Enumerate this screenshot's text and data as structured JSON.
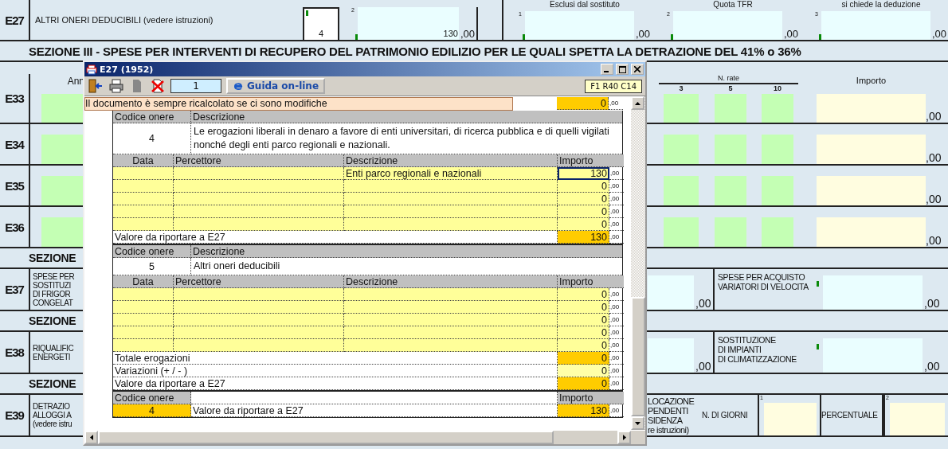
{
  "form": {
    "e27": {
      "code": "E27",
      "label": "ALTRI ONERI DEDUCIBILI (vedere istruzioni)",
      "code_field": "4",
      "amount_index": "2",
      "amount": "130",
      "decimals": ",00"
    },
    "e32": [
      {
        "heading": "Esclusi dal sostituto",
        "index": "1",
        "decimals": ",00"
      },
      {
        "heading": "Quota TFR",
        "index": "2",
        "decimals": ",00"
      },
      {
        "heading": "si chiede la deduzione",
        "index": "3",
        "decimals": ",00"
      }
    ],
    "section_title": "SEZIONE III  -  SPESE PER INTERVENTI DI RECUPERO DEL PATRIMONIO EDILIZIO PER LE QUALI SPETTA LA DETRAZIONE DEL 41% o 36%",
    "rate_header": {
      "year_heading": "Ann",
      "rate_heading": "N. rate",
      "rates": [
        "3",
        "5",
        "10"
      ],
      "amount_heading": "Importo"
    },
    "rate_rows": [
      {
        "code": "E33",
        "decimals": ",00"
      },
      {
        "code": "E34",
        "decimals": ",00"
      },
      {
        "code": "E35",
        "decimals": ",00"
      },
      {
        "code": "E36",
        "decimals": ",00"
      }
    ],
    "lower_sections": [
      {
        "title": "SEZIONE",
        "row": {
          "kind": "split",
          "code": "E37",
          "label_lines": [
            "SPESE PER",
            "SOSTITUZI",
            "DI FRIGOR",
            "CONGELAT"
          ],
          "left_decimals": ",00",
          "right_label_lines": [
            "SPESE PER ACQUISTO",
            "VARIATORI DI VELOCITA"
          ],
          "right_decimals": ",00"
        }
      },
      {
        "title": "SEZIONE",
        "row": {
          "kind": "split",
          "code": "E38",
          "label_lines": [
            "RIQUALIFIC",
            "ENERGETI"
          ],
          "left_decimals": ",00",
          "right_label_lines": [
            "SOSTITUZIONE",
            "DI IMPIANTI",
            "DI CLIMATIZZAZIONE"
          ],
          "right_decimals": ",00"
        }
      },
      {
        "title": "SEZIONE",
        "row": {
          "kind": "lease",
          "code": "E39",
          "label_lines": [
            "DETRAZIO",
            "ALLOGGI A",
            "(vedere istru"
          ],
          "right_label_lines": [
            "LOCAZIONE",
            "PENDENTI",
            "SIDENZA",
            "re istruzioni)"
          ],
          "days_label": "N. DI GIORNI",
          "days_index": "1",
          "percent_label": "PERCENTUALE",
          "percent_index": "2"
        }
      }
    ]
  },
  "dialog": {
    "title": "E27 (1952)",
    "toolbar": {
      "page": "1",
      "help": "Guida on-line",
      "position": "F1 R40 C14"
    },
    "notice": "Il documento è sempre ricalcolato se ci sono modifiche",
    "notice_amount": "0",
    "notice_decimals": ",00",
    "blocks": [
      {
        "code_heading": "Codice onere",
        "description_heading": "Descrizione",
        "code": "4",
        "description": "Le erogazioni liberali in denaro a favore di enti universitari, di ricerca pubblica e di quelli vigilati nonché degli enti parco regionali e nazionali.",
        "columns": [
          "Data",
          "Percettore",
          "Descrizione",
          "Importo"
        ],
        "entries": [
          {
            "description": "Enti parco regionali e nazionali",
            "amount": "130",
            "decimals": ",00",
            "selected": true
          },
          {
            "amount": "0",
            "decimals": ",00",
            "selected": false
          },
          {
            "amount": "0",
            "decimals": ",00",
            "selected": false
          },
          {
            "amount": "0",
            "decimals": ",00",
            "selected": false
          },
          {
            "amount": "0",
            "decimals": ",00",
            "selected": false
          }
        ],
        "totals": [
          {
            "label": "Valore da riportare a E27",
            "amount": "130",
            "decimals": ",00",
            "kind": "computed"
          }
        ]
      },
      {
        "code_heading": "Codice onere",
        "description_heading": "Descrizione",
        "code": "5",
        "description": "Altri oneri deducibili",
        "columns": [
          "Data",
          "Percettore",
          "Descrizione",
          "Importo"
        ],
        "entries": [
          {
            "amount": "0",
            "decimals": ",00",
            "selected": false
          },
          {
            "amount": "0",
            "decimals": ",00",
            "selected": false
          },
          {
            "amount": "0",
            "decimals": ",00",
            "selected": false
          },
          {
            "amount": "0",
            "decimals": ",00",
            "selected": false
          },
          {
            "amount": "0",
            "decimals": ",00",
            "selected": false
          }
        ],
        "totals": [
          {
            "label": "Totale erogazioni",
            "amount": "0",
            "decimals": ",00",
            "kind": "computed"
          },
          {
            "label": "Variazioni (+ / - )",
            "amount": "0",
            "decimals": ",00",
            "kind": "input"
          },
          {
            "label": "Valore da riportare a E27",
            "amount": "0",
            "decimals": ",00",
            "kind": "computed"
          }
        ]
      }
    ],
    "summary": {
      "code_heading": "Codice onere",
      "amount_heading": "Importo",
      "code": "4",
      "label": "Valore da riportare a E27",
      "amount": "130",
      "decimals": ",00"
    }
  }
}
